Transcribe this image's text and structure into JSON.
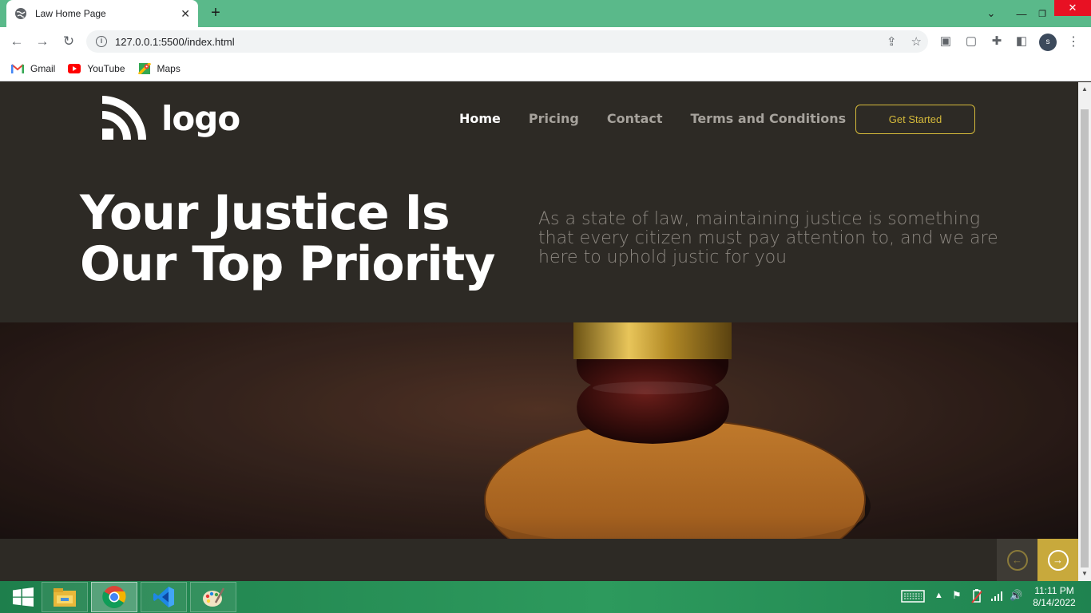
{
  "browser": {
    "tab_title": "Law Home Page",
    "tab_close": "✕",
    "new_tab": "+",
    "url": "127.0.0.1:5500/index.html",
    "profile_initial": "s",
    "bookmarks": [
      {
        "label": "Gmail",
        "icon": "gmail-icon"
      },
      {
        "label": "YouTube",
        "icon": "youtube-icon"
      },
      {
        "label": "Maps",
        "icon": "maps-icon"
      }
    ]
  },
  "site": {
    "logo_text": "logo",
    "nav": [
      {
        "label": "Home",
        "active": true
      },
      {
        "label": "Pricing",
        "active": false
      },
      {
        "label": "Contact",
        "active": false
      },
      {
        "label": "Terms and Conditions",
        "active": false
      }
    ],
    "cta_label": "Get Started",
    "hero": {
      "title": "Your Justice Is Our Top Priority",
      "subtitle": "As a state of law, maintaining justice is something that every citizen must pay attention to, and we are here to uphold justic for you"
    },
    "colors": {
      "background": "#2d2a25",
      "accent": "#c8a93c",
      "nav_active": "#ffffff",
      "nav_inactive": "#a6a29c"
    }
  },
  "taskbar": {
    "apps": [
      "start-icon",
      "file-explorer-icon",
      "chrome-icon",
      "vscode-icon",
      "paint-icon"
    ],
    "time": "11:11 PM",
    "date": "8/14/2022"
  }
}
